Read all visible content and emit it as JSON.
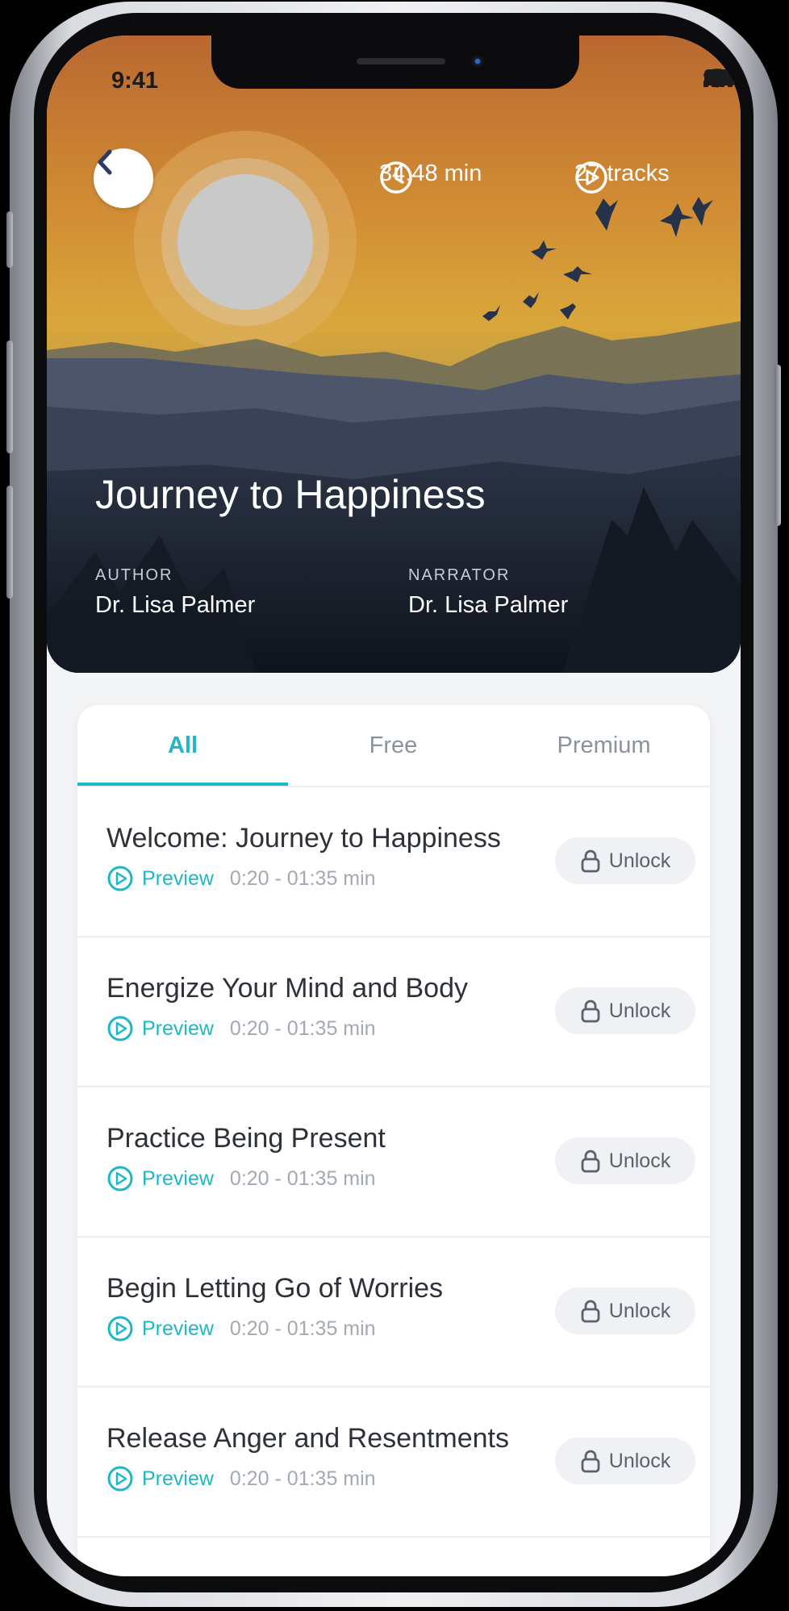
{
  "status": {
    "time": "9:41"
  },
  "header": {
    "duration": "34:48 min",
    "tracks": "27 tracks",
    "title": "Journey to Happiness",
    "author_label": "AUTHOR",
    "author": "Dr. Lisa Palmer",
    "narrator_label": "NARRATOR",
    "narrator": "Dr. Lisa Palmer"
  },
  "tabs": [
    {
      "label": "All",
      "active": true
    },
    {
      "label": "Free",
      "active": false
    },
    {
      "label": "Premium",
      "active": false
    }
  ],
  "tracks": [
    {
      "title": "Welcome: Journey to Happiness",
      "preview": "Preview",
      "range": "0:20 - 01:35 min",
      "action": "Unlock"
    },
    {
      "title": "Energize Your Mind and Body",
      "preview": "Preview",
      "range": "0:20 - 01:35 min",
      "action": "Unlock"
    },
    {
      "title": "Practice Being Present",
      "preview": "Preview",
      "range": "0:20 - 01:35 min",
      "action": "Unlock"
    },
    {
      "title": "Begin Letting Go of Worries",
      "preview": "Preview",
      "range": "0:20 - 01:35 min",
      "action": "Unlock"
    },
    {
      "title": "Release Anger and Resentments",
      "preview": "Preview",
      "range": "0:20 - 01:35 min",
      "action": "Unlock"
    }
  ],
  "colors": {
    "accent": "#1fb7c6",
    "text": "#2d3138",
    "muted": "#a3a9b2"
  },
  "icons": [
    "back-chevron-icon",
    "clock-icon",
    "play-circle-icon",
    "lock-icon",
    "signal-icon",
    "wifi-icon",
    "battery-icon"
  ]
}
